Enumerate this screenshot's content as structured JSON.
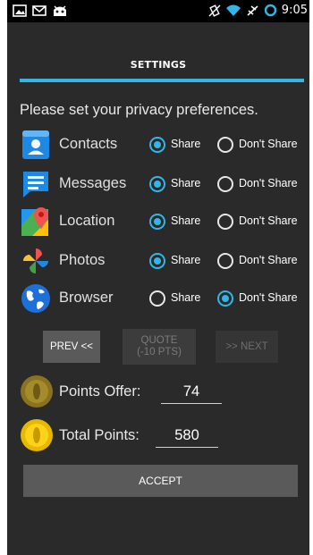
{
  "status_bar": {
    "time": "9:05",
    "left_icons": [
      "gallery-icon",
      "gmail-icon",
      "android-debug-icon"
    ],
    "right_icons": [
      "vibrate-off-icon",
      "wifi-icon",
      "airplane-mode-icon",
      "sync-circle-icon"
    ]
  },
  "header": {
    "title": "SETTINGS",
    "accent_color": "#33b5e5"
  },
  "prompt": "Please set your privacy preferences.",
  "permissions": [
    {
      "label": "Contacts",
      "icon": "contacts-icon",
      "share_label": "Share",
      "dont_label": "Don't Share",
      "selected": "share"
    },
    {
      "label": "Messages",
      "icon": "messages-icon",
      "share_label": "Share",
      "dont_label": "Don't Share",
      "selected": "share"
    },
    {
      "label": "Location",
      "icon": "location-icon",
      "share_label": "Share",
      "dont_label": "Don't Share",
      "selected": "share"
    },
    {
      "label": "Photos",
      "icon": "photos-icon",
      "share_label": "Share",
      "dont_label": "Don't Share",
      "selected": "share"
    },
    {
      "label": "Browser",
      "icon": "browser-icon",
      "share_label": "Share",
      "dont_label": "Don't Share",
      "selected": "dont_share"
    }
  ],
  "nav": {
    "prev_label": "PREV <<",
    "quote_line1": "QUOTE",
    "quote_line2": "(-10 PTS)",
    "next_label": ">> NEXT"
  },
  "points": {
    "offer_label": "Points Offer:",
    "offer_value": "74",
    "total_label": "Total Points:",
    "total_value": "580"
  },
  "accept_label": "ACCEPT"
}
